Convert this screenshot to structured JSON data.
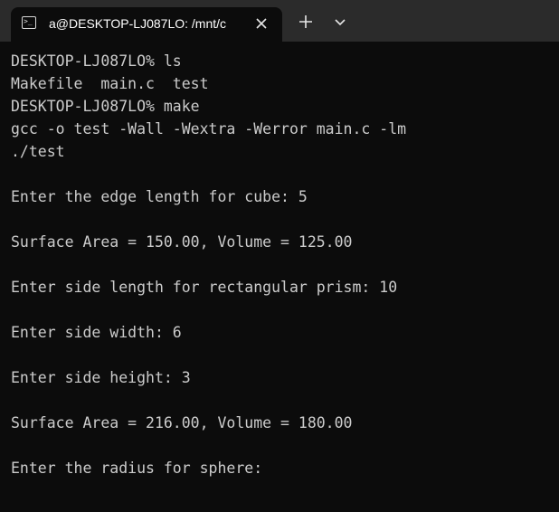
{
  "tab": {
    "title": "a@DESKTOP-LJ087LO: /mnt/c",
    "icon": "terminal-icon"
  },
  "terminal": {
    "lines": [
      "DESKTOP-LJ087LO% ls",
      "Makefile  main.c  test",
      "DESKTOP-LJ087LO% make",
      "gcc -o test -Wall -Wextra -Werror main.c -lm",
      "./test",
      "",
      "Enter the edge length for cube: 5",
      "",
      "Surface Area = 150.00, Volume = 125.00",
      "",
      "Enter side length for rectangular prism: 10",
      "",
      "Enter side width: 6",
      "",
      "Enter side height: 3",
      "",
      "Surface Area = 216.00, Volume = 180.00",
      "",
      "Enter the radius for sphere:"
    ]
  },
  "colors": {
    "tabbar_bg": "#2b2b2b",
    "terminal_bg": "#0c0c0c",
    "text": "#cccccc"
  }
}
